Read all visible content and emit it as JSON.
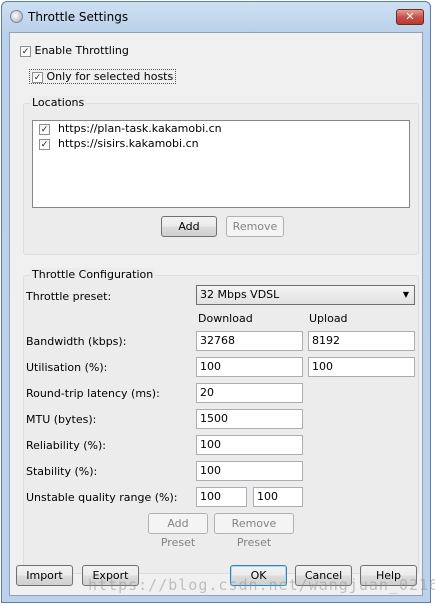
{
  "window": {
    "title": "Throttle Settings",
    "close_glyph": "✕"
  },
  "options": {
    "enable_throttling": {
      "label": "Enable Throttling",
      "checked": true
    },
    "only_selected_hosts": {
      "label": "Only for selected hosts",
      "checked": true
    }
  },
  "locations": {
    "title": "Locations",
    "items": [
      {
        "url": "https://plan-task.kakamobi.cn",
        "checked": true
      },
      {
        "url": "https://sisirs.kakamobi.cn",
        "checked": true
      }
    ],
    "add_label": "Add",
    "remove_label": "Remove"
  },
  "throttle": {
    "title": "Throttle Configuration",
    "preset_label": "Throttle preset:",
    "preset_value": "32 Mbps VDSL",
    "col_download": "Download",
    "col_upload": "Upload",
    "rows": {
      "bandwidth": {
        "label": "Bandwidth (kbps):",
        "download": "32768",
        "upload": "8192"
      },
      "utilisation": {
        "label": "Utilisation (%):",
        "download": "100",
        "upload": "100"
      },
      "latency": {
        "label": "Round-trip latency (ms):",
        "value": "20"
      },
      "mtu": {
        "label": "MTU (bytes):",
        "value": "1500"
      },
      "reliability": {
        "label": "Reliability (%):",
        "value": "100"
      },
      "stability": {
        "label": "Stability (%):",
        "value": "100"
      },
      "unstable": {
        "label": "Unstable quality range (%):",
        "min": "100",
        "max": "100"
      }
    },
    "add_preset_label": "Add Preset",
    "remove_preset_label": "Remove Preset"
  },
  "footer": {
    "import_label": "Import",
    "export_label": "Export",
    "ok_label": "OK",
    "cancel_label": "Cancel",
    "help_label": "Help"
  },
  "watermark": "https://blog.csdn.net/wangjuan_0216",
  "colors": {
    "titlebar": "#c4d8ee",
    "client": "#f0f0f0",
    "close": "#c75050"
  }
}
